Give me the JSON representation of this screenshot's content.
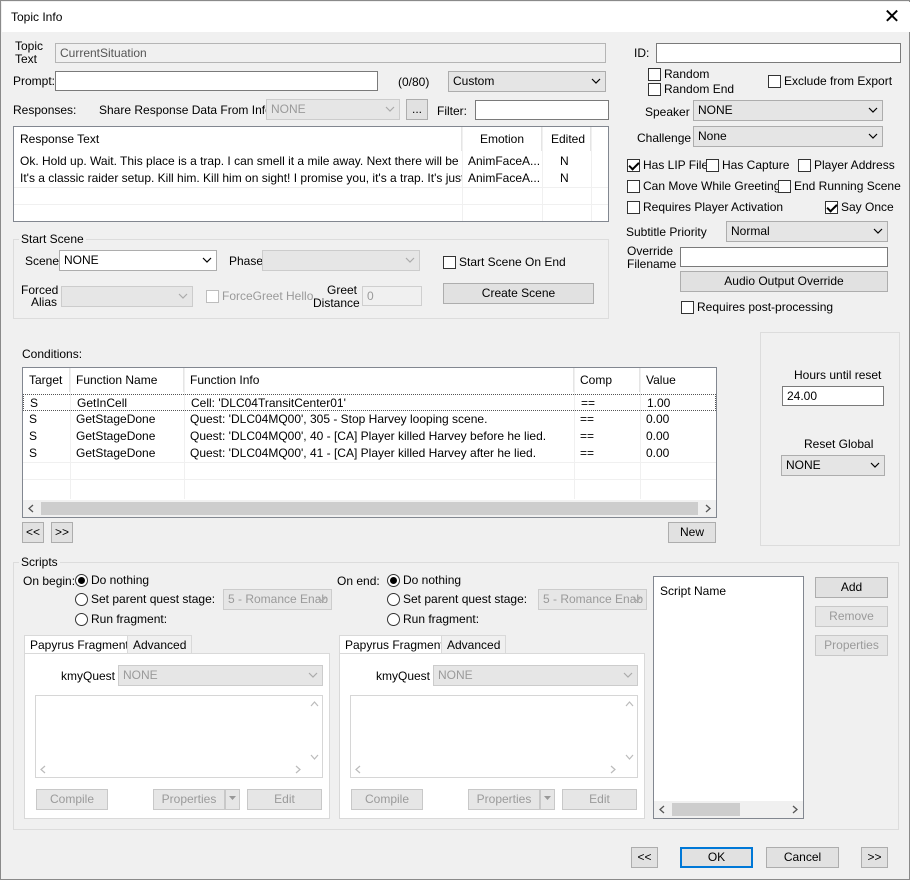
{
  "window": {
    "title": "Topic Info"
  },
  "topic": {
    "label_topic": "Topic",
    "label_text": "Text",
    "value": "CurrentSituation"
  },
  "prompt": {
    "label": "Prompt:",
    "value": "",
    "counter": "(0/80)",
    "dropdown": "Custom"
  },
  "responses_bar": {
    "label": "Responses:",
    "share_label": "Share Response Data From Info:",
    "share_value": "NONE",
    "ellipsis": "...",
    "filter_label": "Filter:",
    "filter_value": ""
  },
  "responses": {
    "headers": [
      "Response Text",
      "Emotion",
      "Edited"
    ],
    "rows": [
      {
        "text": "Ok. Hold up. Wait. This place is a trap. I can smell it a mile away. Next there will be a gu...",
        "emotion": "AnimFaceA...",
        "edited": "N"
      },
      {
        "text": "It's a classic raider setup. Kill him. Kill him on sight! I promise you, it's a trap. It's just the ...",
        "emotion": "AnimFaceA...",
        "edited": "N"
      }
    ]
  },
  "start_scene": {
    "group": "Start Scene",
    "scene_label": "Scene",
    "scene_value": "NONE",
    "phase_label": "Phase",
    "start_on_end": "Start Scene On End",
    "forced_label_1": "Forced",
    "forced_label_2": "Alias",
    "forcegreet": "ForceGreet Hello",
    "greet_label_1": "Greet",
    "greet_label_2": "Distance",
    "greet_value": "0",
    "create": "Create Scene"
  },
  "right": {
    "id_label": "ID:",
    "id_value": "",
    "random": "Random",
    "random_end": "Random End",
    "exclude": "Exclude from Export",
    "speaker_label": "Speaker",
    "speaker_value": "NONE",
    "challenge_label": "Challenge",
    "challenge_value": "None",
    "has_lip": "Has LIP File",
    "has_capture": "Has Capture",
    "player_address": "Player Address",
    "can_move": "Can Move While Greeting",
    "end_running": "End Running Scene",
    "requires_activation": "Requires Player Activation",
    "say_once": "Say Once",
    "subtitle_label": "Subtitle Priority",
    "subtitle_value": "Normal",
    "override_1": "Override",
    "override_2": "Filename",
    "override_value": "",
    "audio_override": "Audio Output Override",
    "post_processing": "Requires post-processing"
  },
  "conditions": {
    "label": "Conditions:",
    "headers": [
      "Target",
      "Function Name",
      "Function Info",
      "Comp",
      "Value"
    ],
    "rows": [
      {
        "target": "S",
        "func": "GetInCell",
        "info": "Cell: 'DLC04TransitCenter01'",
        "comp": "==",
        "value": "1.00"
      },
      {
        "target": "S",
        "func": "GetStageDone",
        "info": "Quest: 'DLC04MQ00', 305 - Stop Harvey looping scene.",
        "comp": "==",
        "value": "0.00"
      },
      {
        "target": "S",
        "func": "GetStageDone",
        "info": "Quest: 'DLC04MQ00', 40 - [CA] Player killed Harvey before he lied.",
        "comp": "==",
        "value": "0.00"
      },
      {
        "target": "S",
        "func": "GetStageDone",
        "info": "Quest: 'DLC04MQ00', 41 - [CA] Player killed Harvey after he lied.",
        "comp": "==",
        "value": "0.00"
      }
    ],
    "prev": "<<",
    "next": ">>",
    "new": "New"
  },
  "reset": {
    "hours_label": "Hours until reset",
    "hours_value": "24.00",
    "global_label": "Reset Global",
    "global_value": "NONE"
  },
  "scripts": {
    "group": "Scripts",
    "on_begin": "On begin:",
    "on_end": "On end:",
    "do_nothing": "Do nothing",
    "set_stage": "Set parent quest stage:",
    "run_fragment": "Run fragment:",
    "stage_value": "5 - Romance Enab",
    "tab_papyrus": "Papyrus Fragment",
    "tab_advanced": "Advanced",
    "quest_label": "kmyQuest",
    "quest_value": "NONE",
    "compile": "Compile",
    "properties": "Properties",
    "edit": "Edit",
    "script_name": "Script Name",
    "add": "Add",
    "remove": "Remove",
    "props": "Properties"
  },
  "footer": {
    "prev": "<<",
    "ok": "OK",
    "cancel": "Cancel",
    "next": ">>"
  }
}
